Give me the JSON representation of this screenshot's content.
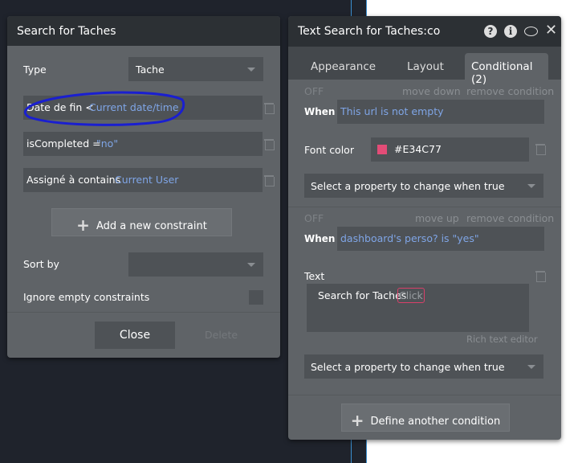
{
  "left_panel": {
    "title": "Search for Taches",
    "type_label": "Type",
    "type_value": "Tache",
    "constraints": [
      {
        "field": "Date de fin <",
        "value": "Current date/time"
      },
      {
        "field": "isCompleted =",
        "value": "\"no\""
      },
      {
        "field": "Assigné à contains",
        "value": "Current User"
      }
    ],
    "add_constraint": "Add a new constraint",
    "sort_by_label": "Sort by",
    "sort_by_value": "",
    "ignore_empty_label": "Ignore empty constraints",
    "close": "Close",
    "delete": "Delete"
  },
  "right_panel": {
    "title": "Text Search for Taches:co",
    "tabs": [
      "Appearance",
      "Layout",
      "Conditional (2)"
    ],
    "active_tab": 2,
    "conditions": [
      {
        "state": "OFF",
        "move": "move down",
        "remove": "remove condition",
        "when_label": "When",
        "when": "This url is not empty",
        "property": "Font color",
        "color": "#E34C77",
        "select": "Select a property to change when true"
      },
      {
        "state": "OFF",
        "move": "move up",
        "remove": "remove condition",
        "when_label": "When",
        "when": "dashboard's perso? is \"yes\"",
        "property": "Text",
        "text_value": "Search for Taches",
        "text_chip": "Click",
        "rich_editor": "Rich text editor",
        "select": "Select a property to change when true"
      }
    ],
    "define_another": "Define another condition"
  }
}
